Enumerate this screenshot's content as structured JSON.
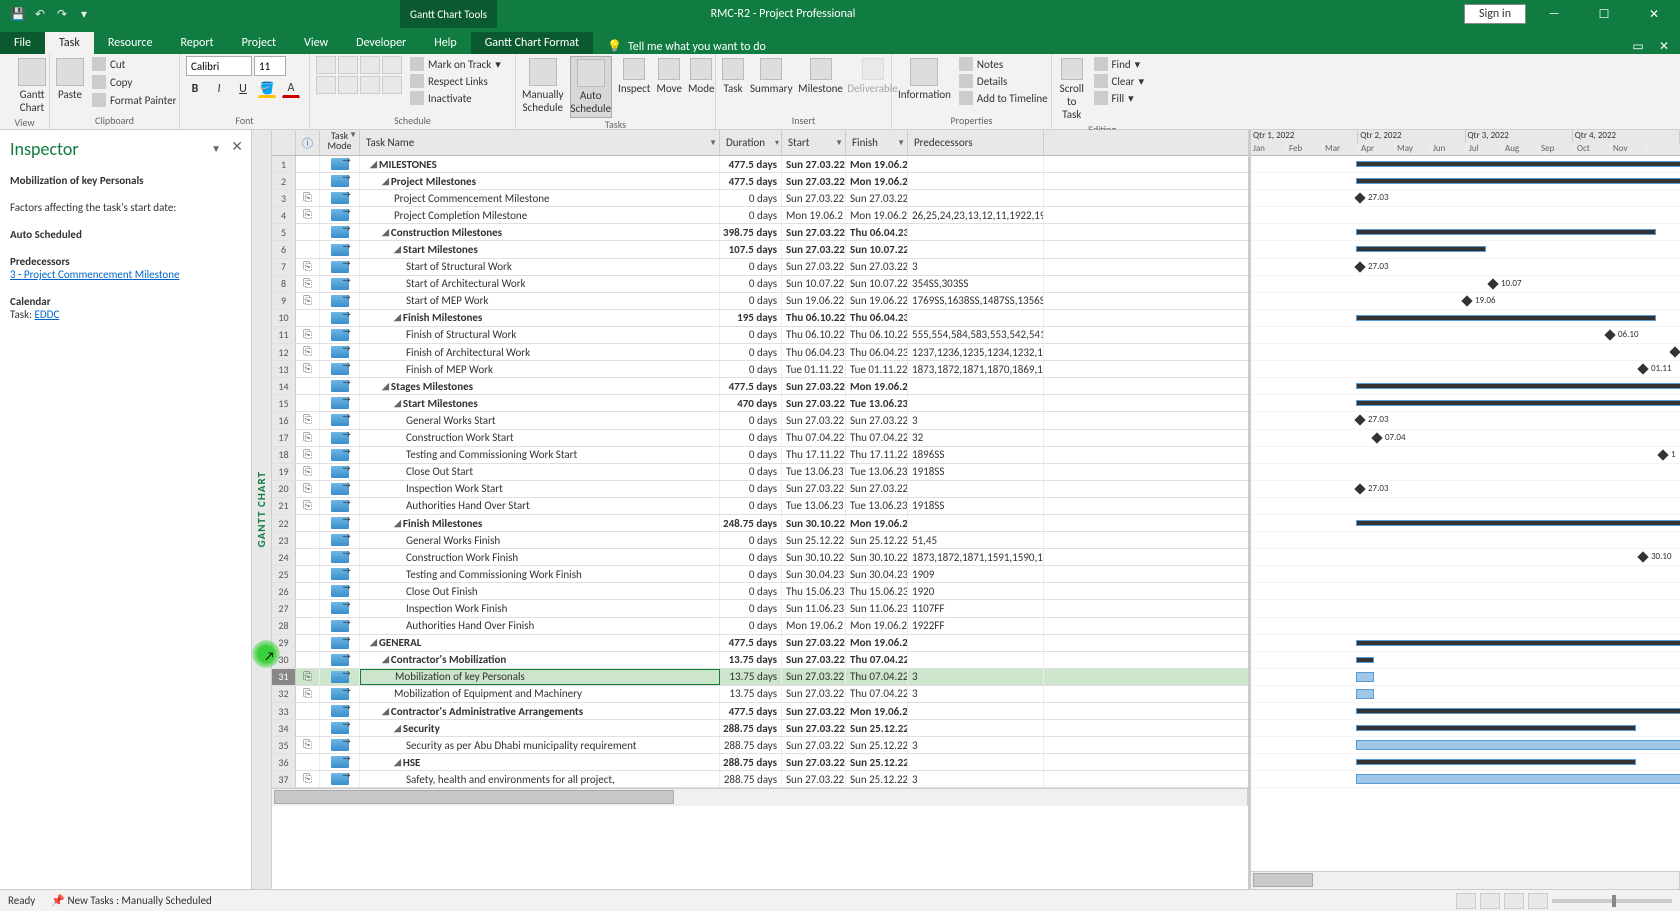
{
  "title": "RMC-R2  -  Project Professional",
  "context_tab": "Gantt Chart Tools",
  "signin": "Sign in",
  "menu": [
    "File",
    "Task",
    "Resource",
    "Report",
    "Project",
    "View",
    "Developer",
    "Help"
  ],
  "menu_context": "Gantt Chart Format",
  "tellme": "Tell me what you want to do",
  "ribbon": {
    "view_label": "View",
    "gantt": "Gantt\nChart",
    "paste": "Paste",
    "cut": "Cut",
    "copy": "Copy",
    "fmtpainter": "Format Painter",
    "clipboard": "Clipboard",
    "font": "Font",
    "fontname": "Calibri",
    "fontsize": "11",
    "schedule": "Schedule",
    "markontrack": "Mark on Track",
    "respectlinks": "Respect Links",
    "inactivate": "Inactivate",
    "manual": "Manually\nSchedule",
    "auto": "Auto\nSchedule",
    "tasks": "Tasks",
    "inspect": "Inspect",
    "move": "Move",
    "modebtn": "Mode",
    "task": "Task",
    "summary": "Summary",
    "milestone": "Milestone",
    "deliverable": "Deliverable",
    "insert": "Insert",
    "information": "Information",
    "notes": "Notes",
    "details": "Details",
    "addtimeline": "Add to Timeline",
    "properties": "Properties",
    "scroll": "Scroll\nto Task",
    "find": "Find",
    "clear": "Clear",
    "fill": "Fill",
    "editing": "Editing"
  },
  "inspector": {
    "title": "Inspector",
    "taskname": "Mobilization of  key Personals",
    "factors": "Factors affecting the task's start date:",
    "auto": "Auto Scheduled",
    "pred_h": "Predecessors",
    "pred_link": "3 - Project Commencement Milestone",
    "cal_h": "Calendar",
    "cal_task": "Task:",
    "cal_link": "EDDC"
  },
  "vertical": "GANTT CHART",
  "columns": {
    "info": "ⓘ",
    "mode1": "Task",
    "mode2": "Mode",
    "name": "Task Name",
    "dur": "Duration",
    "start": "Start",
    "finish": "Finish",
    "pred": "Predecessors"
  },
  "rows": [
    {
      "n": 1,
      "ind": 0,
      "sum": true,
      "name": "MILESTONES",
      "dur": "477.5 days",
      "s": "Sun 27.03.22",
      "f": "Mon 19.06.2",
      "p": ""
    },
    {
      "n": 2,
      "ind": 1,
      "sum": true,
      "name": "Project Milestones",
      "dur": "477.5 days",
      "s": "Sun 27.03.22",
      "f": "Mon 19.06.2",
      "p": ""
    },
    {
      "n": 3,
      "ind": 2,
      "i": "⎘",
      "name": "Project Commencement Milestone",
      "dur": "0 days",
      "s": "Sun 27.03.22",
      "f": "Sun 27.03.22",
      "p": ""
    },
    {
      "n": 4,
      "ind": 2,
      "i": "⎘",
      "name": "Project Completion Milestone",
      "dur": "0 days",
      "s": "Mon 19.06.2",
      "f": "Mon 19.06.2",
      "p": "26,25,24,23,13,12,11,1922,19"
    },
    {
      "n": 5,
      "ind": 1,
      "sum": true,
      "name": "Construction Milestones",
      "dur": "398.75 days",
      "s": "Sun 27.03.22",
      "f": "Thu 06.04.23",
      "p": ""
    },
    {
      "n": 6,
      "ind": 2,
      "sum": true,
      "name": "Start Milestones",
      "dur": "107.5 days",
      "s": "Sun 27.03.22",
      "f": "Sun 10.07.22",
      "p": ""
    },
    {
      "n": 7,
      "ind": 3,
      "i": "⎘",
      "name": "Start of Structural Work",
      "dur": "0 days",
      "s": "Sun 27.03.22",
      "f": "Sun 27.03.22",
      "p": "3"
    },
    {
      "n": 8,
      "ind": 3,
      "i": "⎘",
      "name": "Start of Architectural Work",
      "dur": "0 days",
      "s": "Sun 10.07.22",
      "f": "Sun 10.07.22",
      "p": "354SS,303SS"
    },
    {
      "n": 9,
      "ind": 3,
      "i": "⎘",
      "name": "Start of MEP Work",
      "dur": "0 days",
      "s": "Sun 19.06.22",
      "f": "Sun 19.06.22",
      "p": "1769SS,1638SS,1487SS,1356S"
    },
    {
      "n": 10,
      "ind": 2,
      "sum": true,
      "name": "Finish Milestones",
      "dur": "195 days",
      "s": "Thu 06.10.22",
      "f": "Thu 06.04.23",
      "p": ""
    },
    {
      "n": 11,
      "ind": 3,
      "i": "⎘",
      "name": "Finish of Structural Work",
      "dur": "0 days",
      "s": "Thu 06.10.22",
      "f": "Thu 06.10.22",
      "p": "555,554,584,583,553,542,541"
    },
    {
      "n": 12,
      "ind": 3,
      "i": "⎘",
      "name": "Finish of Architectural Work",
      "dur": "0 days",
      "s": "Thu 06.04.23",
      "f": "Thu 06.04.23",
      "p": "1237,1236,1235,1234,1232,12"
    },
    {
      "n": 13,
      "ind": 3,
      "i": "⎘",
      "name": "Finish of MEP Work",
      "dur": "0 days",
      "s": "Tue 01.11.22",
      "f": "Tue 01.11.22",
      "p": "1873,1872,1871,1870,1869,18"
    },
    {
      "n": 14,
      "ind": 1,
      "sum": true,
      "name": "Stages Milestones",
      "dur": "477.5 days",
      "s": "Sun 27.03.22",
      "f": "Mon 19.06.2",
      "p": ""
    },
    {
      "n": 15,
      "ind": 2,
      "sum": true,
      "name": "Start Milestones",
      "dur": "470 days",
      "s": "Sun 27.03.22",
      "f": "Tue 13.06.23",
      "p": ""
    },
    {
      "n": 16,
      "ind": 3,
      "i": "⎘",
      "name": "General Works Start",
      "dur": "0 days",
      "s": "Sun 27.03.22",
      "f": "Sun 27.03.22",
      "p": "3"
    },
    {
      "n": 17,
      "ind": 3,
      "i": "⎘",
      "name": "Construction Work Start",
      "dur": "0 days",
      "s": "Thu 07.04.22",
      "f": "Thu 07.04.22",
      "p": "32"
    },
    {
      "n": 18,
      "ind": 3,
      "i": "⎘",
      "name": "Testing and Commissioning Work Start",
      "dur": "0 days",
      "s": "Thu 17.11.22",
      "f": "Thu 17.11.22",
      "p": "1896SS"
    },
    {
      "n": 19,
      "ind": 3,
      "i": "⎘",
      "name": "Close Out Start",
      "dur": "0 days",
      "s": "Tue 13.06.23",
      "f": "Tue 13.06.23",
      "p": "1918SS"
    },
    {
      "n": 20,
      "ind": 3,
      "i": "⎘",
      "name": "Inspection Work Start",
      "dur": "0 days",
      "s": "Sun 27.03.22",
      "f": "Sun 27.03.22",
      "p": ""
    },
    {
      "n": 21,
      "ind": 3,
      "i": "⎘",
      "name": "Authorities Hand Over Start",
      "dur": "0 days",
      "s": "Tue 13.06.23",
      "f": "Tue 13.06.23",
      "p": "1918SS"
    },
    {
      "n": 22,
      "ind": 2,
      "sum": true,
      "name": "Finish Milestones",
      "dur": "248.75 days",
      "s": "Sun 30.10.22",
      "f": "Mon 19.06.2",
      "p": ""
    },
    {
      "n": 23,
      "ind": 3,
      "name": "General Works Finish",
      "dur": "0 days",
      "s": "Sun 25.12.22",
      "f": "Sun 25.12.22",
      "p": "51,45"
    },
    {
      "n": 24,
      "ind": 3,
      "name": "Construction Work Finish",
      "dur": "0 days",
      "s": "Sun 30.10.22",
      "f": "Sun 30.10.22",
      "p": "1873,1872,1871,1591,1590,15"
    },
    {
      "n": 25,
      "ind": 3,
      "name": "Testing and Commissioning Work Finish",
      "dur": "0 days",
      "s": "Sun 30.04.23",
      "f": "Sun 30.04.23",
      "p": "1909"
    },
    {
      "n": 26,
      "ind": 3,
      "name": "Close Out Finish",
      "dur": "0 days",
      "s": "Thu 15.06.23",
      "f": "Thu 15.06.23",
      "p": "1920"
    },
    {
      "n": 27,
      "ind": 3,
      "name": "Inspection Work Finish",
      "dur": "0 days",
      "s": "Sun 11.06.23",
      "f": "Sun 11.06.23",
      "p": "1107FF"
    },
    {
      "n": 28,
      "ind": 3,
      "name": "Authorities Hand Over Finish",
      "dur": "0 days",
      "s": "Mon 19.06.2",
      "f": "Mon 19.06.2",
      "p": "1922FF"
    },
    {
      "n": 29,
      "ind": 0,
      "sum": true,
      "name": "GENERAL",
      "dur": "477.5 days",
      "s": "Sun 27.03.22",
      "f": "Mon 19.06.2",
      "p": ""
    },
    {
      "n": 30,
      "ind": 1,
      "sum": true,
      "name": "Contractor's Mobilization",
      "dur": "13.75 days",
      "s": "Sun 27.03.22",
      "f": "Thu 07.04.22",
      "p": ""
    },
    {
      "n": 31,
      "ind": 2,
      "i": "⎘",
      "sel": true,
      "name": "Mobilization of  key Personals",
      "dur": "13.75 days",
      "s": "Sun 27.03.22",
      "f": "Thu 07.04.22",
      "p": "3"
    },
    {
      "n": 32,
      "ind": 2,
      "i": "⎘",
      "name": "Mobilization of Equipment and Machinery",
      "dur": "13.75 days",
      "s": "Sun 27.03.22",
      "f": "Thu 07.04.22",
      "p": "3"
    },
    {
      "n": 33,
      "ind": 1,
      "sum": true,
      "name": "Contractor's Administrative Arrangements",
      "dur": "477.5 days",
      "s": "Sun 27.03.22",
      "f": "Mon 19.06.2",
      "p": ""
    },
    {
      "n": 34,
      "ind": 2,
      "sum": true,
      "name": "Security",
      "dur": "288.75 days",
      "s": "Sun 27.03.22",
      "f": "Sun 25.12.22",
      "p": ""
    },
    {
      "n": 35,
      "ind": 3,
      "i": "⎘",
      "name": "Security as per Abu Dhabi municipality requirement",
      "dur": "288.75 days",
      "s": "Sun 27.03.22",
      "f": "Sun 25.12.22",
      "p": "3"
    },
    {
      "n": 36,
      "ind": 2,
      "sum": true,
      "name": "HSE",
      "dur": "288.75 days",
      "s": "Sun 27.03.22",
      "f": "Sun 25.12.22",
      "p": ""
    },
    {
      "n": 37,
      "ind": 3,
      "i": "⎘",
      "name": "Safety, health and environments for all project,",
      "dur": "288.75 days",
      "s": "Sun 27.03.22",
      "f": "Sun 25.12.22",
      "p": "3"
    }
  ],
  "quarters": [
    "Qtr 1, 2022",
    "Qtr 2, 2022",
    "Qtr 3, 2022",
    "Qtr 4, 2022"
  ],
  "months": [
    "Jan",
    "Feb",
    "Mar",
    "Apr",
    "May",
    "Jun",
    "Jul",
    "Aug",
    "Sep",
    "Oct",
    "Nov"
  ],
  "gantt_labels": {
    "r3": "27.03",
    "r7": "27.03",
    "r8": "10.07",
    "r9": "19.06",
    "r11": "06.10",
    "r13": "01.11",
    "r16": "27.03",
    "r17": "07.04",
    "r18": "1",
    "r20": "27.03",
    "r24": "30.10"
  },
  "status": {
    "ready": "Ready",
    "newtasks": "New Tasks : Manually Scheduled"
  }
}
